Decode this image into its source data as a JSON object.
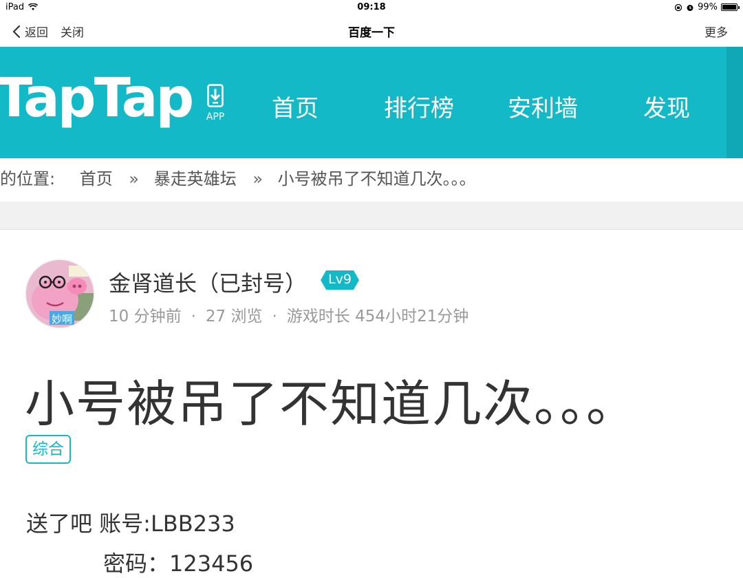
{
  "status_bar": {
    "device": "iPad",
    "time": "09:18",
    "battery": "99%",
    "battery_level": 0.99
  },
  "browser": {
    "back_label": "返回",
    "close_label": "关闭",
    "title": "百度一下",
    "more_label": "更多"
  },
  "site": {
    "logo": "TapTap",
    "app_label": "APP",
    "nav": [
      "首页",
      "排行榜",
      "安利墙",
      "发现"
    ],
    "accent_color": "#14b9c8"
  },
  "breadcrumb": {
    "prefix": "的位置:",
    "items": [
      "首页",
      "暴走英雄坛",
      "小号被吊了不知道几次。。。"
    ],
    "separator": "»"
  },
  "post": {
    "author": "金肾道长（已封号）",
    "level": "Lv9",
    "avatar_caption": "妙啊",
    "time_ago": "10 分钟前",
    "views": "27 浏览",
    "play_time": "游戏时长 454小时21分钟",
    "title": "小号被吊了不知道几次。。。",
    "tag": "综合",
    "body": [
      "送了吧 账号:LBB233",
      "密码：123456"
    ]
  }
}
